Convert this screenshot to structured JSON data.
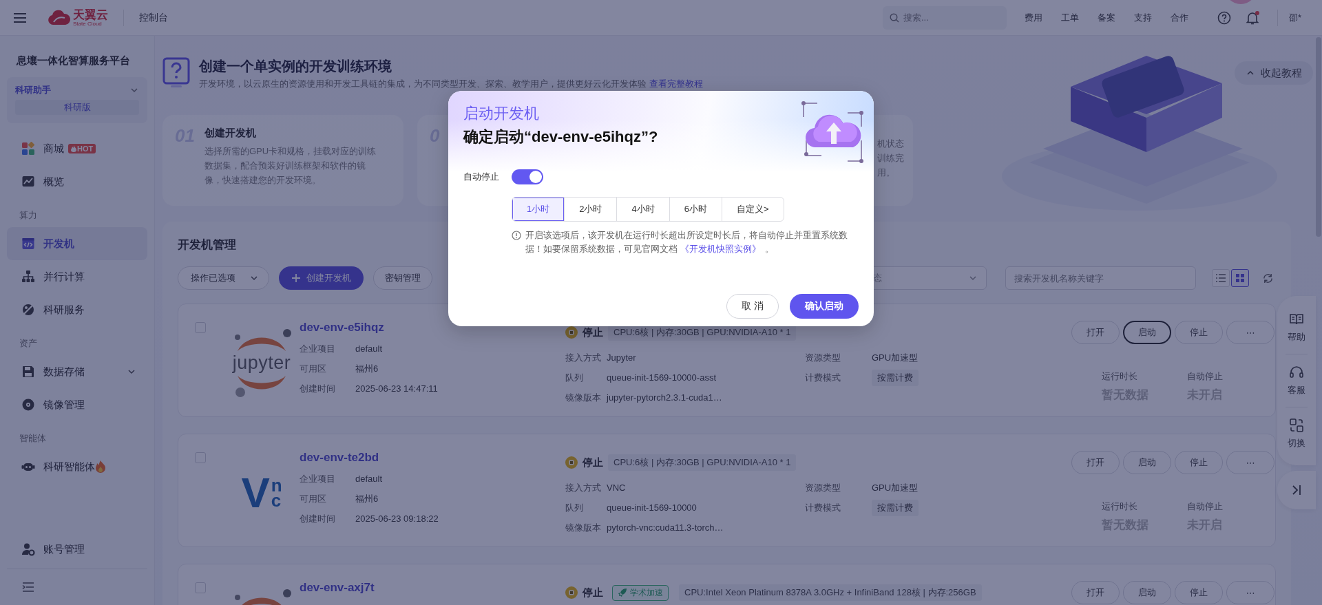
{
  "topbar": {
    "logo_name": "天翼云",
    "logo_sub": "State Cloud",
    "console": "控制台",
    "search": {
      "placeholder": "搜索..."
    },
    "links": [
      "费用",
      "工单",
      "备案",
      "支持",
      "合作"
    ],
    "notification_unread": true,
    "user": "邵*"
  },
  "sidebar": {
    "title": "息壤一体化智算服务平台",
    "workspace": {
      "name": "科研助手",
      "edition": "科研版"
    },
    "items": [
      {
        "kind": "item",
        "label": "商城",
        "badge": "HOT",
        "selected": false
      },
      {
        "kind": "item",
        "label": "概览",
        "selected": false
      },
      {
        "kind": "section",
        "label": "算力"
      },
      {
        "kind": "item",
        "label": "开发机",
        "selected": true
      },
      {
        "kind": "item",
        "label": "并行计算",
        "selected": false
      },
      {
        "kind": "item",
        "label": "科研服务",
        "selected": false
      },
      {
        "kind": "section",
        "label": "资产"
      },
      {
        "kind": "item",
        "label": "数据存储",
        "expanded": false,
        "selected": false
      },
      {
        "kind": "item",
        "label": "镜像管理",
        "selected": false
      },
      {
        "kind": "section",
        "label": "智能体"
      },
      {
        "kind": "item",
        "label": "科研智能体",
        "selected": false
      }
    ],
    "footer_item": {
      "label": "账号管理",
      "selected": false
    }
  },
  "tutorial": {
    "title": "创建一个单实例的开发训练环境",
    "desc": "开发环境，以云原生的资源使用和开发工具链的集成，为不同类型开发、探索、教学用户，提供更好云化开发体验",
    "link": "查看完整教程",
    "collapse": "收起教程",
    "steps": [
      {
        "num": "01",
        "title": "创建开发机",
        "desc": "选择所需的GPU卡和规格，挂载对应的训练数据集，配合预装好训练框架和软件的镜像，快速搭建您的开发环境。"
      },
      {
        "num": "0"
      },
      {
        "desc_lines": [
          "机状态",
          "训练完",
          "用。"
        ]
      }
    ]
  },
  "panel": {
    "title": "开发机管理",
    "bulk_action": "操作已选项",
    "create": "创建开发机",
    "keys": "密钥管理",
    "status_filter": "态",
    "search": {
      "placeholder": "搜索开发机名称关键字"
    },
    "views": [
      {
        "kind": "list",
        "selected": false
      },
      {
        "kind": "grid",
        "selected": true
      }
    ],
    "cards": [
      {
        "name": "dev-env-e5ihqz",
        "logo": {
          "kind": "jupyter",
          "text": "jupyter"
        },
        "checked": false,
        "fields": [
          {
            "label": "企业项目",
            "value": "default"
          },
          {
            "label": "可用区",
            "value": "福州6"
          },
          {
            "label": "创建时间",
            "value": "2025-06-23 14:47:11"
          }
        ],
        "status": {
          "label": "停止",
          "kind": "stopped"
        },
        "spec": "CPU:6核 | 内存:30GB | GPU:NVIDIA-A10 * 1",
        "details": [
          {
            "label": "接入方式",
            "value": "Jupyter",
            "kind": "text"
          },
          {
            "label": "资源类型",
            "value": "GPU加速型",
            "kind": "text"
          },
          {
            "label": "队列",
            "value": "queue-init-1569-10000-asst",
            "kind": "text"
          },
          {
            "label": "计费模式",
            "value": "按需计费",
            "kind": "tag"
          },
          {
            "label": "镜像版本",
            "value": "jupyter-pytorch2.3.1-cuda1…",
            "kind": "text"
          }
        ],
        "actions": [
          {
            "label": "打开",
            "focused": false
          },
          {
            "label": "启动",
            "focused": true
          },
          {
            "label": "停止",
            "focused": false
          },
          {
            "label": "⋯",
            "focused": false
          }
        ],
        "runtime": {
          "label": "运行时长",
          "value": "暂无数据"
        },
        "autostop": {
          "label": "自动停止",
          "value": "未开启"
        }
      },
      {
        "name": "dev-env-te2bd",
        "logo": {
          "kind": "vnc",
          "text": "Vnc"
        },
        "checked": false,
        "fields": [
          {
            "label": "企业项目",
            "value": "default"
          },
          {
            "label": "可用区",
            "value": "福州6"
          },
          {
            "label": "创建时间",
            "value": "2025-06-23 09:18:22"
          }
        ],
        "status": {
          "label": "停止",
          "kind": "stopped"
        },
        "spec": "CPU:6核 | 内存:30GB | GPU:NVIDIA-A10 * 1",
        "details": [
          {
            "label": "接入方式",
            "value": "VNC",
            "kind": "text"
          },
          {
            "label": "资源类型",
            "value": "GPU加速型",
            "kind": "text"
          },
          {
            "label": "队列",
            "value": "queue-init-1569-10000",
            "kind": "text"
          },
          {
            "label": "计费模式",
            "value": "按需计费",
            "kind": "tag"
          },
          {
            "label": "镜像版本",
            "value": "pytorch-vnc:cuda11.3-torch…",
            "kind": "text"
          }
        ],
        "actions": [
          {
            "label": "打开",
            "focused": false
          },
          {
            "label": "启动",
            "focused": false
          },
          {
            "label": "停止",
            "focused": false
          },
          {
            "label": "⋯",
            "focused": false
          }
        ],
        "runtime": {
          "label": "运行时长",
          "value": "暂无数据"
        },
        "autostop": {
          "label": "自动停止",
          "value": "未开启"
        }
      },
      {
        "name": "dev-env-axj7t",
        "logo": {
          "kind": "jupyter"
        },
        "checked": false,
        "status": {
          "label": "停止",
          "kind": "stopped"
        },
        "tags": [
          {
            "label": "学术加速",
            "kind": "accelerate"
          }
        ],
        "spec": "CPU:Intel Xeon Platinum 8378A 3.0GHz + InfiniBand 128核 | 内存:256GB",
        "actions": [
          {
            "label": "打开",
            "focused": false
          },
          {
            "label": "启动",
            "focused": false
          },
          {
            "label": "停止",
            "focused": false
          },
          {
            "label": "⋯",
            "focused": false
          }
        ]
      }
    ]
  },
  "dock": {
    "items": [
      {
        "label": "帮助"
      },
      {
        "label": "客服"
      },
      {
        "label": "切换"
      }
    ]
  },
  "dialog": {
    "title": "启动开发机",
    "question": "确定启动“dev-env-e5ihqz”?",
    "auto_stop": {
      "label": "自动停止",
      "on": true
    },
    "durations": [
      {
        "label": "1小时",
        "selected": true
      },
      {
        "label": "2小时",
        "selected": false
      },
      {
        "label": "4小时",
        "selected": false
      },
      {
        "label": "6小时",
        "selected": false
      },
      {
        "label": "自定义>",
        "selected": false
      }
    ],
    "notice": "开启该选项后，该开发机在运行时长超出所设定时长后，将自动停止并重置系统数据！如要保留系统数据，可见官网文档",
    "notice_link": "《开发机快照实例》",
    "notice_end": "。",
    "cancel": "取 消",
    "confirm": "确认启动"
  }
}
